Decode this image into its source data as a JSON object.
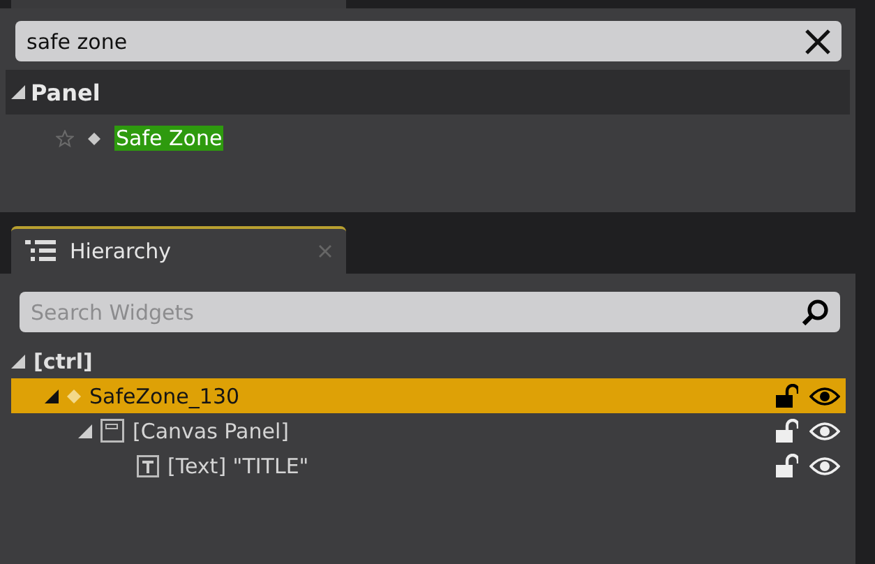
{
  "palette": {
    "search": {
      "value": "safe zone"
    },
    "categories": [
      {
        "label": "Panel",
        "expanded": true,
        "items": [
          {
            "label": "Safe Zone",
            "favorite": false,
            "matched": true
          }
        ]
      }
    ]
  },
  "hierarchy": {
    "tab": {
      "label": "Hierarchy",
      "selected": true
    },
    "search": {
      "placeholder": "Search Widgets"
    },
    "tree": [
      {
        "label": "[ctrl]",
        "kind": "root",
        "expanded": true,
        "selected": false,
        "children": [
          {
            "label": "SafeZone_130",
            "kind": "safezone",
            "expanded": true,
            "selected": true,
            "locked": false,
            "visible": true,
            "children": [
              {
                "label": "[Canvas Panel]",
                "kind": "canvas",
                "expanded": true,
                "selected": false,
                "locked": false,
                "visible": true,
                "children": [
                  {
                    "label": "[Text] \"TITLE\"",
                    "kind": "text",
                    "selected": false,
                    "locked": false,
                    "visible": true
                  }
                ]
              }
            ]
          }
        ]
      }
    ]
  }
}
